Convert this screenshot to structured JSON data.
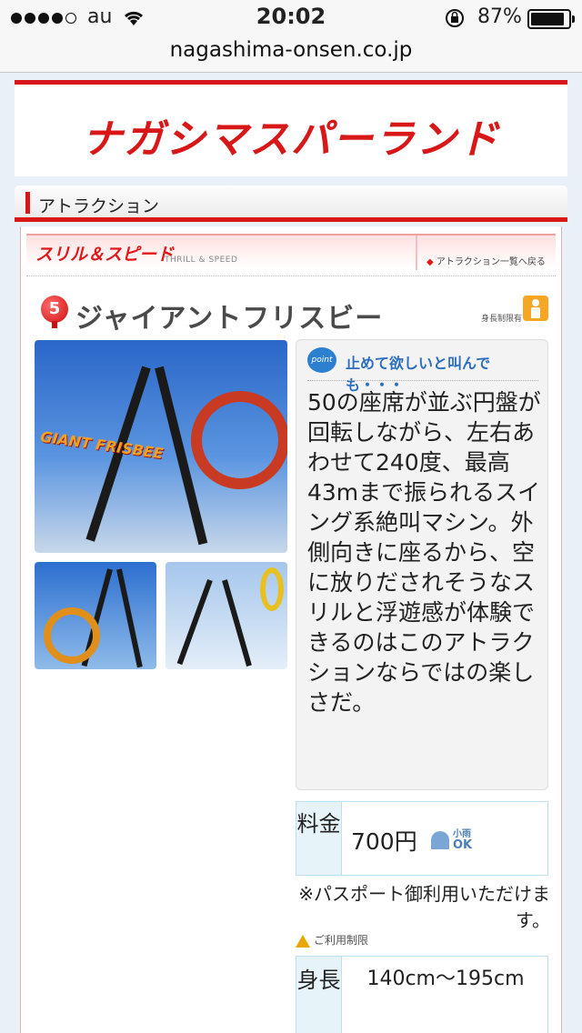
{
  "status_bar": {
    "carrier": "au",
    "time": "20:02",
    "battery": "87%",
    "icons": [
      "signal-dots",
      "wifi-icon",
      "rotation-lock-icon",
      "battery-icon"
    ]
  },
  "browser": {
    "url": "nagashima-onsen.co.jp"
  },
  "header": {
    "logo_text": "ナガシマスパーランド"
  },
  "section": {
    "title": "アトラクション"
  },
  "category": {
    "label": "スリル＆スピード",
    "label_en": "THRILL & SPEED",
    "back_link": "アトラクション一覧へ戻る"
  },
  "attraction": {
    "number": "5",
    "name": "ジャイアントフリスビー",
    "height_limit_label": "身長制限有",
    "photo_text": "GIANT FRISBEE"
  },
  "description": {
    "point_badge": "point",
    "point_title": "止めて欲しいと叫んでも・・・",
    "body": "50の座席が並ぶ円盤が回転しながら、左右あわせて240度、最高43mまで振られるスイング系絶叫マシン。外側向きに座るから、空に放りだされそうなスリルと浮遊感が体験できるのはこのアトラクションならではの楽しさだ。"
  },
  "price": {
    "header": "料金",
    "value": "700円",
    "rain_label": "小雨",
    "rain_ok": "OK",
    "note": "※パスポート御利用いただけます。"
  },
  "restrictions": {
    "heading": "ご利用制限",
    "height_header": "身長",
    "height_value": "140cm〜195cm"
  },
  "colors": {
    "brand_red": "#d81818",
    "point_blue": "#2d7fcf",
    "table_border": "#bfe0f0"
  }
}
